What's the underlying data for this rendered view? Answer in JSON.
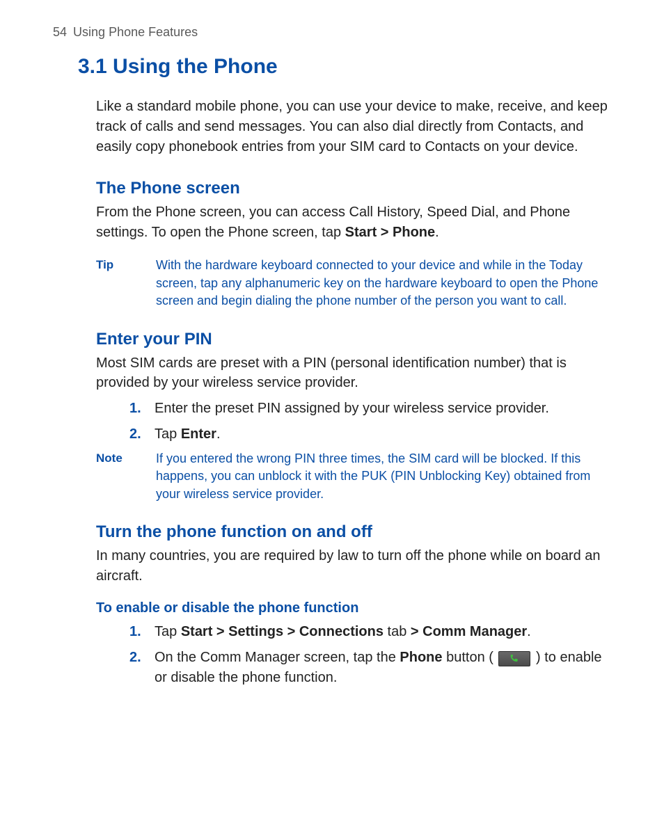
{
  "header": {
    "page_number": "54",
    "chapter_title": "Using Phone Features"
  },
  "title": "3.1  Using the Phone",
  "intro": "Like a standard mobile phone, you can use your device to make, receive, and keep track of calls and send messages. You can also dial directly from Contacts, and easily copy phonebook entries from your SIM card to Contacts on your device.",
  "sections": {
    "phone_screen": {
      "heading": "The Phone screen",
      "body_pre": "From the Phone screen, you can access Call History, Speed Dial, and Phone settings. To open the Phone screen, tap ",
      "body_bold": "Start > Phone",
      "body_post": ".",
      "tip_label": "Tip",
      "tip_body": "With the hardware keyboard connected to your device and while in the Today screen, tap any alphanumeric key on the hardware keyboard to open the Phone screen and begin dialing the phone number of the person you want to call."
    },
    "enter_pin": {
      "heading": "Enter your PIN",
      "body": "Most SIM cards are preset with a PIN (personal identification number) that is provided by your wireless service provider.",
      "steps": {
        "n1": "1.",
        "s1": "Enter the preset PIN assigned by your wireless service provider.",
        "n2": "2.",
        "s2_pre": "Tap ",
        "s2_bold": "Enter",
        "s2_post": "."
      },
      "note_label": "Note",
      "note_body": "If you entered the wrong PIN three times, the SIM card will be blocked. If this happens, you can unblock it with the PUK (PIN Unblocking Key) obtained from your wireless service provider."
    },
    "turn_onoff": {
      "heading": "Turn the phone function on and off",
      "body": "In many countries, you are required by law to turn off the phone while on board an aircraft.",
      "sub_heading": "To enable or disable the phone function",
      "steps": {
        "n1": "1.",
        "s1_pre": "Tap ",
        "s1_b1": "Start > Settings > Connections",
        "s1_mid": " tab ",
        "s1_b2": "> Comm Manager",
        "s1_post": ".",
        "n2": "2.",
        "s2_pre": "On the Comm Manager screen, tap the ",
        "s2_bold": "Phone",
        "s2_mid": " button  ( ",
        "s2_post": " ) to enable or disable the phone function."
      }
    }
  }
}
